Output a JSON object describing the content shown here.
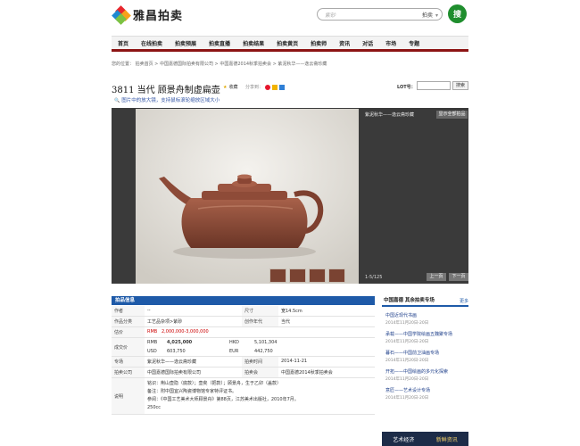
{
  "header": {
    "site_name": "雅昌拍卖",
    "search_placeholder": "紫砂",
    "search_scope": "拍卖",
    "search_button": "搜",
    "logo_colors": [
      "#e8262d",
      "#f7a21b",
      "#1e88d0",
      "#7cc242"
    ]
  },
  "nav": {
    "items": [
      "首页",
      "在线拍卖",
      "拍卖预展",
      "拍卖直播",
      "拍卖结果",
      "拍卖黄页",
      "拍卖师",
      "资讯",
      "对话",
      "市场",
      "专题"
    ]
  },
  "breadcrumb": "您的位置： 拍卖首页 > 中国嘉德国际拍卖有限公司 > 中国嘉德2014秋季拍卖会 > 紫泥秋华——逸云斋珍藏",
  "lot": {
    "title": "3811 当代 顾景舟制虚扁壶",
    "favorite_label": "收藏",
    "share_label": "分享到：",
    "lot_no_label": "LOT号：",
    "search_button": "搜索",
    "hint": "图片中的放大镜，支持鼠标滚轮缩放区域大小"
  },
  "viewer": {
    "session_title": "紫泥秋华——逸云斋珍藏",
    "show_all_button": "显示全部拍品",
    "counter": "1-5/125",
    "prev_button": "上一页",
    "next_button": "下一页"
  },
  "info": {
    "header": "拍品信息",
    "author_label": "作者",
    "author_value": "--",
    "size_label": "尺寸",
    "size_value": "宽14.5cm",
    "category_label": "作品分类",
    "category_value": "工艺品杂项>紫砂",
    "era_label": "创作年代",
    "era_value": "当代",
    "estimate_label": "估价",
    "estimate_currency": "RMB",
    "estimate_value": "2,000,000-3,000,000",
    "deal_label": "成交价",
    "deal_rows": [
      {
        "cur1": "RMB",
        "val1": "4,025,000",
        "cur2": "HKD",
        "val2": "5,101,304"
      },
      {
        "cur1": "USD",
        "val1": "603,750",
        "cur2": "EUR",
        "val2": "442,750"
      }
    ],
    "session_label": "专场",
    "session_value": "紫泥秋华——逸云斋珍藏",
    "date_label": "拍卖时间",
    "date_value": "2014-11-21",
    "company_label": "拍卖公司",
    "company_value": "中国嘉德国际拍卖有限公司",
    "auction_label": "拍卖会",
    "auction_value": "中国嘉德2014秋季拍卖会",
    "desc_label": "说明",
    "desc_lines": [
      "铭识：荆山壶隐（底款）；壶矣（把款）；顾景舟，生于乙卯（盖款）",
      "备注：附中国宜兴陶瓷博物馆专家特评证书。",
      "参阅：《中国工艺美术大师顾景舟》第88页，江苏美术出版社，2010年7月。",
      "250cc"
    ]
  },
  "sidebar": {
    "title": "中国嘉德 其余拍卖专场",
    "more": "更多",
    "items": [
      {
        "name": "中国近现代书画",
        "date": "2014年11月20日-20日"
      },
      {
        "name": "承载——中国学院绘画五魏聚专场",
        "date": "2014年11月20日-20日"
      },
      {
        "name": "暮石——中国前卫油画专场",
        "date": "2014年11月20日-20日"
      },
      {
        "name": "开拓——中国绘画的多元化探索",
        "date": "2014年11月20日-20日"
      },
      {
        "name": "意匠——艺术设计专场",
        "date": "2014年11月20日-20日"
      }
    ],
    "ad_left": "艺术经济",
    "ad_right": "新鲜资讯"
  }
}
